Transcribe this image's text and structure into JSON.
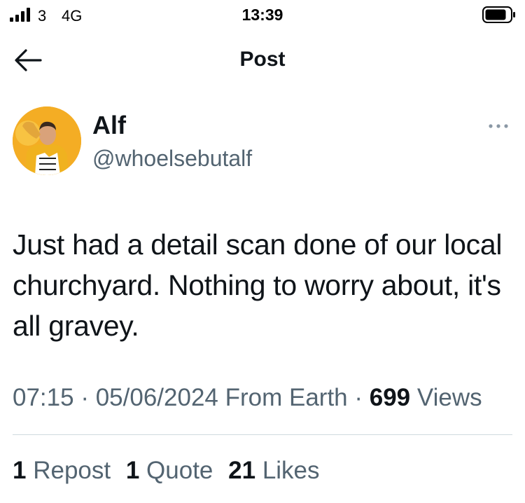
{
  "status_bar": {
    "carrier": "3",
    "network": "4G",
    "time": "13:39"
  },
  "nav": {
    "title": "Post"
  },
  "author": {
    "display_name": "Alf",
    "handle": "@whoelsebutalf"
  },
  "post": {
    "text": "Just had a detail scan done of our local churchyard. Nothing to worry about, it's all gravey."
  },
  "meta": {
    "time": "07:15",
    "separator": " · ",
    "date": "05/06/2024",
    "location": " From Earth",
    "separator2": " · ",
    "views_count": "699",
    "views_label": " Views"
  },
  "stats": {
    "reposts_count": "1",
    "reposts_label": "Repost",
    "quotes_count": "1",
    "quotes_label": "Quote",
    "likes_count": "21",
    "likes_label": "Likes"
  },
  "colors": {
    "text_primary": "#0f1419",
    "text_secondary": "#536471",
    "divider": "#cfd9de",
    "avatar_bg": "#f4a91f"
  },
  "icons": [
    "signal-icon",
    "battery-icon",
    "back-arrow-icon",
    "more-options-icon"
  ]
}
